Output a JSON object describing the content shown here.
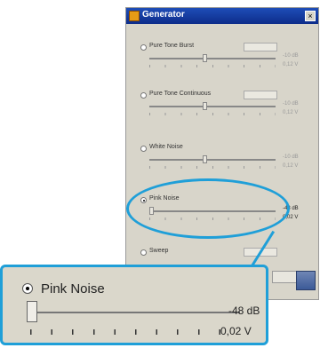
{
  "window": {
    "title": "Generator",
    "close_glyph": "×"
  },
  "sections": [
    {
      "label": "Pure Tone Burst",
      "db": "-10 dB",
      "v": "0,12 V"
    },
    {
      "label": "Pure Tone Continuous",
      "db": "-10 dB",
      "v": "0,12 V"
    },
    {
      "label": "White Noise",
      "db": "-10 dB",
      "v": "0,12 V"
    },
    {
      "label": "Pink Noise",
      "db": "-48 dB",
      "v": "0,02 V"
    },
    {
      "label": "Sweep"
    }
  ],
  "zoom": {
    "label": "Pink Noise",
    "level_db": "-48 dB",
    "voltage": "0,02 V"
  },
  "colors": {
    "callout": "#1f9fd8",
    "titlebar": "#1e4db7"
  }
}
